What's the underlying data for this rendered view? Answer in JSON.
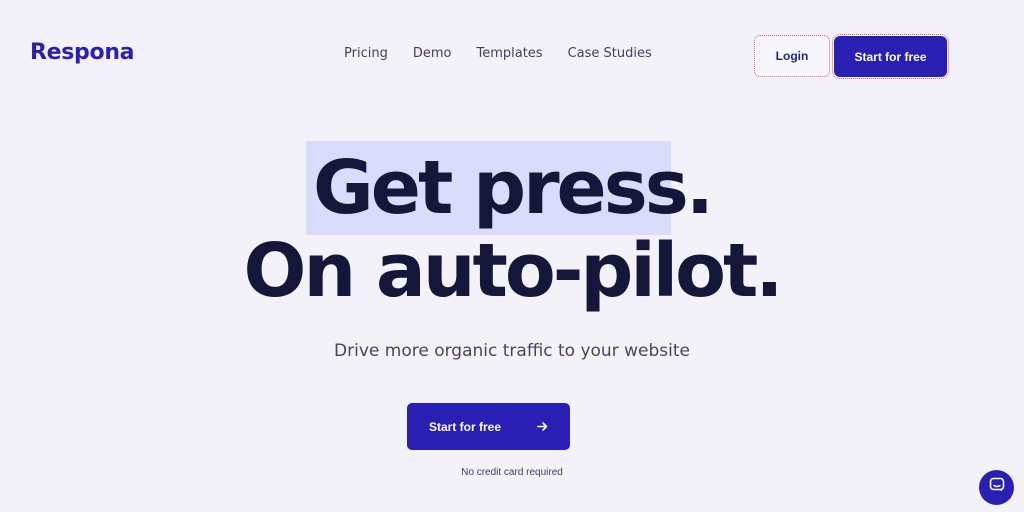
{
  "header": {
    "logo": "Respona",
    "nav": [
      "Pricing",
      "Demo",
      "Templates",
      "Case Studies"
    ],
    "login_label": "Login",
    "start_label": "Start for free"
  },
  "hero": {
    "line1": "Get press.",
    "line2": "On auto-pilot.",
    "subtitle": "Drive more organic traffic to your website",
    "cta_label": "Start for free",
    "cta_icon": "arrow-right-icon",
    "note": "No credit card required"
  },
  "chat": {
    "icon": "chat-bubble-icon"
  },
  "colors": {
    "brand": "#2a1fb3",
    "highlight": "#d9dcfb",
    "heading": "#14163a",
    "background": "#f2f2f8"
  }
}
